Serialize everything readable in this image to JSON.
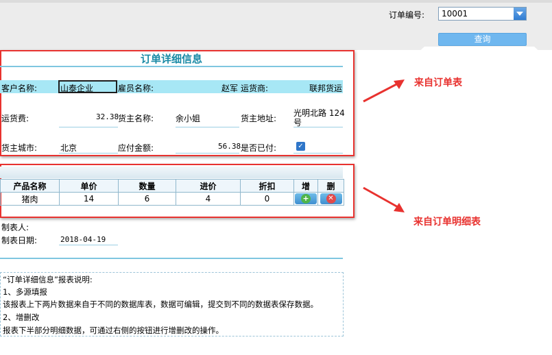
{
  "toolbar": {
    "order_no_label": "订单编号:",
    "order_no_value": "10001",
    "query_label": "查询"
  },
  "order": {
    "title": "订单详细信息",
    "customer_label": "客户名称:",
    "customer_value": "山泰企业",
    "employee_label": "雇员名称:",
    "employee_value": "赵军",
    "shipper_label": "运货商:",
    "shipper_value": "联邦货运",
    "freight_label": "运货费:",
    "freight_value": "32.38",
    "consignee_label": "货主名称:",
    "consignee_value": "余小姐",
    "address_label": "货主地址:",
    "address_value_line1": "光明北路 124",
    "address_value_line2": "号",
    "city_label": "货主城市:",
    "city_value": "北京",
    "amount_label": "应付金额:",
    "amount_value": "56.38",
    "paid_label": "是否已付:",
    "paid_checked": true
  },
  "detail": {
    "columns": [
      "产品名称",
      "单价",
      "数量",
      "进价",
      "折扣",
      "增",
      "删"
    ],
    "rows": [
      {
        "product": "猪肉",
        "price": "14",
        "qty": "6",
        "cost": "4",
        "discount": "0"
      }
    ]
  },
  "footer": {
    "maker_label": "制表人:",
    "date_label": "制表日期:",
    "date_value": "2018-04-19"
  },
  "notes": {
    "from_order": "来自订单表",
    "from_detail": "来自订单明细表",
    "accent": "#e8322f"
  },
  "description": {
    "line1": "“订单详细信息”报表说明:",
    "line2": "1、多源填报",
    "line3": "该报表上下两片数据来自于不同的数据库表，数据可编辑，提交到不同的数据表保存数据。",
    "line4": "2、增删改",
    "line5": "报表下半部分明细数据，可通过右侧的按钮进行增删改的操作。"
  }
}
